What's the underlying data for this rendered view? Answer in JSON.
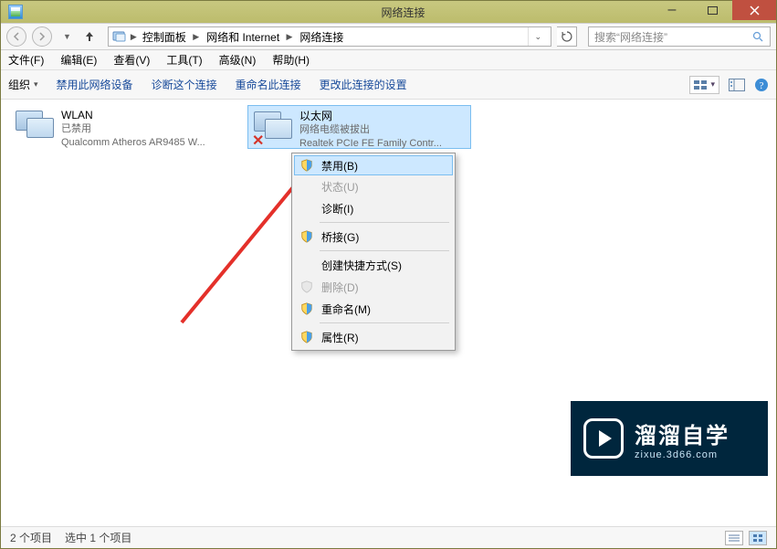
{
  "window": {
    "title": "网络连接"
  },
  "winbuttons": {
    "min_label": "–",
    "max_label": "▢"
  },
  "breadcrumb": {
    "items": [
      "控制面板",
      "网络和 Internet",
      "网络连接"
    ]
  },
  "search": {
    "placeholder": "搜索“网络连接”"
  },
  "menubar": {
    "file": "文件(F)",
    "edit": "编辑(E)",
    "view": "查看(V)",
    "tools": "工具(T)",
    "advanced": "高级(N)",
    "help": "帮助(H)"
  },
  "toolbar": {
    "organize": "组织",
    "org_arrow": "▾",
    "disable": "禁用此网络设备",
    "diagnose": "诊断这个连接",
    "rename": "重命名此连接",
    "changesettings": "更改此连接的设置"
  },
  "items": [
    {
      "name": "WLAN",
      "status": "已禁用",
      "desc": "Qualcomm Atheros AR9485 W..."
    },
    {
      "name": "以太网",
      "status": "网络电缆被拔出",
      "desc": "Realtek PCIe FE Family Contr..."
    }
  ],
  "context": {
    "disable": "禁用(B)",
    "status": "状态(U)",
    "diagnose": "诊断(I)",
    "bridge": "桥接(G)",
    "shortcut": "创建快捷方式(S)",
    "delete": "删除(D)",
    "rename": "重命名(M)",
    "properties": "属性(R)"
  },
  "statusbar": {
    "count": "2 个项目",
    "selected": "选中 1 个项目"
  },
  "watermark": {
    "title": "溜溜自学",
    "domain": "zixue.3d66.com"
  }
}
